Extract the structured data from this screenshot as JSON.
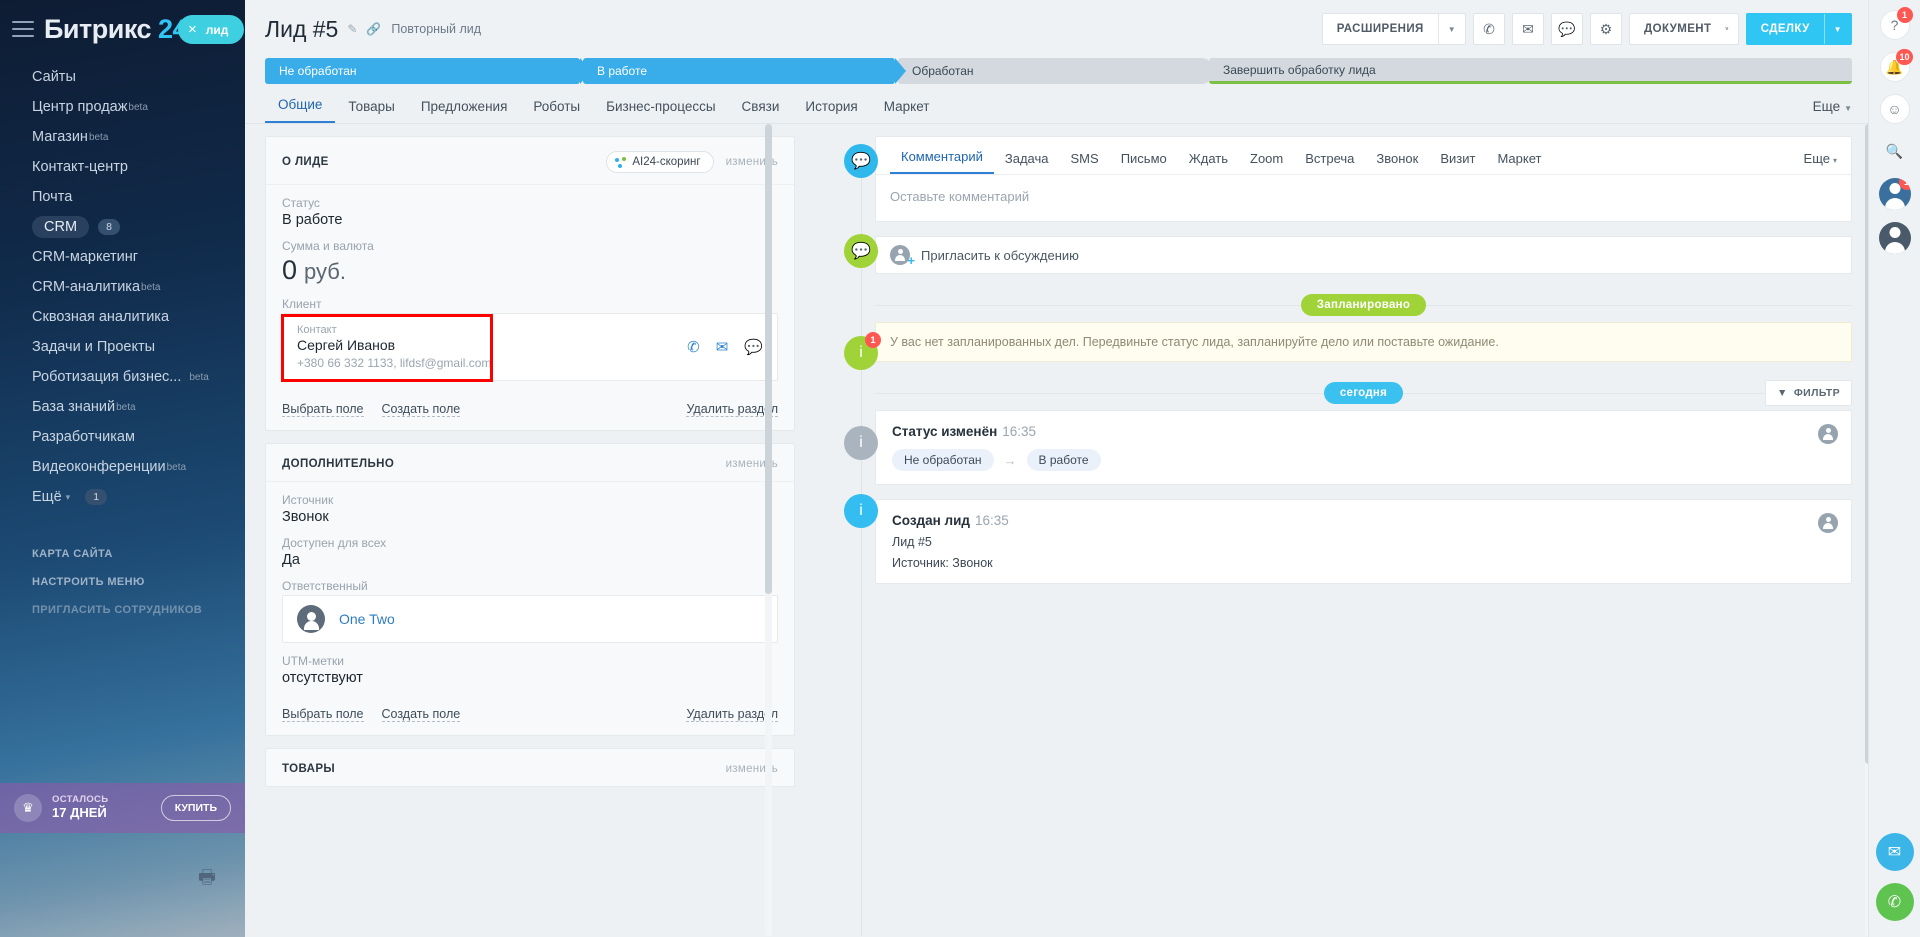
{
  "sidebar": {
    "logo": {
      "brand": "Битрикс",
      "number": "24"
    },
    "lead_pill": {
      "close": "×",
      "label": "лид"
    },
    "items": [
      {
        "label": "Сайты",
        "sup": "",
        "active": false,
        "count": ""
      },
      {
        "label": "Центр продаж",
        "sup": "beta",
        "active": false,
        "count": ""
      },
      {
        "label": "Магазин",
        "sup": "beta",
        "active": false,
        "count": ""
      },
      {
        "label": "Контакт-центр",
        "sup": "",
        "active": false,
        "count": ""
      },
      {
        "label": "Почта",
        "sup": "",
        "active": false,
        "count": ""
      },
      {
        "label": "CRM",
        "sup": "",
        "active": true,
        "count": "8"
      },
      {
        "label": "CRM-маркетинг",
        "sup": "",
        "active": false,
        "count": ""
      },
      {
        "label": "CRM-аналитика",
        "sup": "beta",
        "active": false,
        "count": ""
      },
      {
        "label": "Сквозная аналитика",
        "sup": "",
        "active": false,
        "count": ""
      },
      {
        "label": "Задачи и Проекты",
        "sup": "",
        "active": false,
        "count": ""
      },
      {
        "label": "Роботизация бизнес...",
        "sup": "beta",
        "active": false,
        "count": ""
      },
      {
        "label": "База знаний",
        "sup": "beta",
        "active": false,
        "count": ""
      },
      {
        "label": "Разработчикам",
        "sup": "",
        "active": false,
        "count": ""
      },
      {
        "label": "Видеоконференции",
        "sup": "beta",
        "active": false,
        "count": ""
      }
    ],
    "more": {
      "label": "Ещё",
      "count": "1"
    },
    "links": [
      "КАРТА САЙТА",
      "НАСТРОИТЬ МЕНЮ",
      "ПРИГЛАСИТЬ СОТРУДНИКОВ"
    ],
    "promo": {
      "top": "ОСТАЛОСЬ",
      "bottom": "17 ДНЕЙ",
      "button": "КУПИТЬ"
    }
  },
  "topbar": {
    "title": "Лид #5",
    "subtitle": "Повторный лид",
    "extensions_label": "РАСШИРЕНИЯ",
    "document_label": "ДОКУМЕНТ",
    "deal_label": "СДЕЛКУ"
  },
  "stages": [
    {
      "label": "Не обработан",
      "state": "done"
    },
    {
      "label": "В работе",
      "state": "done"
    },
    {
      "label": "Обработан",
      "state": "todo"
    },
    {
      "label": "Завершить обработку лида",
      "state": "final"
    }
  ],
  "tabs": {
    "items": [
      "Общие",
      "Товары",
      "Предложения",
      "Роботы",
      "Бизнес-процессы",
      "Связи",
      "История",
      "Маркет"
    ],
    "active": "Общие",
    "more": "Еще"
  },
  "about_card": {
    "title": "О ЛИДЕ",
    "ai_badge": "AI24-скоринг",
    "edit": "изменить",
    "status_label": "Статус",
    "status_value": "В работе",
    "amount_label": "Сумма и валюта",
    "amount_value": "0",
    "amount_currency": "руб.",
    "client_label": "Клиент",
    "contact_label": "Контакт",
    "contact_name": "Сергей Иванов",
    "contact_details": "+380 66 332 1133, lifdsf@gmail.com",
    "foot": {
      "select_field": "Выбрать поле",
      "create_field": "Создать поле",
      "delete_section": "Удалить раздел"
    }
  },
  "extra_card": {
    "title": "ДОПОЛНИТЕЛЬНО",
    "edit": "изменить",
    "source_label": "Источник",
    "source_value": "Звонок",
    "available_label": "Доступен для всех",
    "available_value": "Да",
    "responsible_label": "Ответственный",
    "responsible_name": "One Two",
    "utm_label": "UTM-метки",
    "utm_value": "отсутствуют",
    "foot": {
      "select_field": "Выбрать поле",
      "create_field": "Создать поле",
      "delete_section": "Удалить раздел"
    }
  },
  "products_card": {
    "title": "ТОВАРЫ",
    "edit": "изменить"
  },
  "activity": {
    "tabs": [
      "Комментарий",
      "Задача",
      "SMS",
      "Письмо",
      "Ждать",
      "Zoom",
      "Встреча",
      "Звонок",
      "Визит",
      "Маркет"
    ],
    "active_tab": "Комментарий",
    "more": "Еще",
    "comment_placeholder": "Оставьте комментарий",
    "invite_label": "Пригласить к обсуждению",
    "planned_chip": "Запланировано",
    "warning": "У вас нет запланированных дел. Передвиньте статус лида, запланируйте дело или поставьте ожидание.",
    "warning_badge": "1",
    "today_chip": "сегодня",
    "filter_label": "ФИЛЬТР",
    "events": [
      {
        "title": "Статус изменён",
        "time": "16:35",
        "from_tag": "Не обработан",
        "to_tag": "В работе",
        "lines": []
      },
      {
        "title": "Создан лид",
        "time": "16:35",
        "from_tag": "",
        "to_tag": "",
        "lines": [
          "Лид #5",
          "Источник: Звонок"
        ]
      }
    ]
  },
  "rail": {
    "notify_badge": "1",
    "bell_badge": "10",
    "avatar_badge": "1"
  },
  "colors": {
    "accent_blue": "#2fc6f3",
    "stage_done": "#38ade9",
    "stage_todo": "#d3d9de",
    "stage_final_underline": "#7cc043",
    "green_chip": "#9fd338",
    "highlight_red": "#ff0000",
    "link_blue": "#2f7cc4"
  }
}
